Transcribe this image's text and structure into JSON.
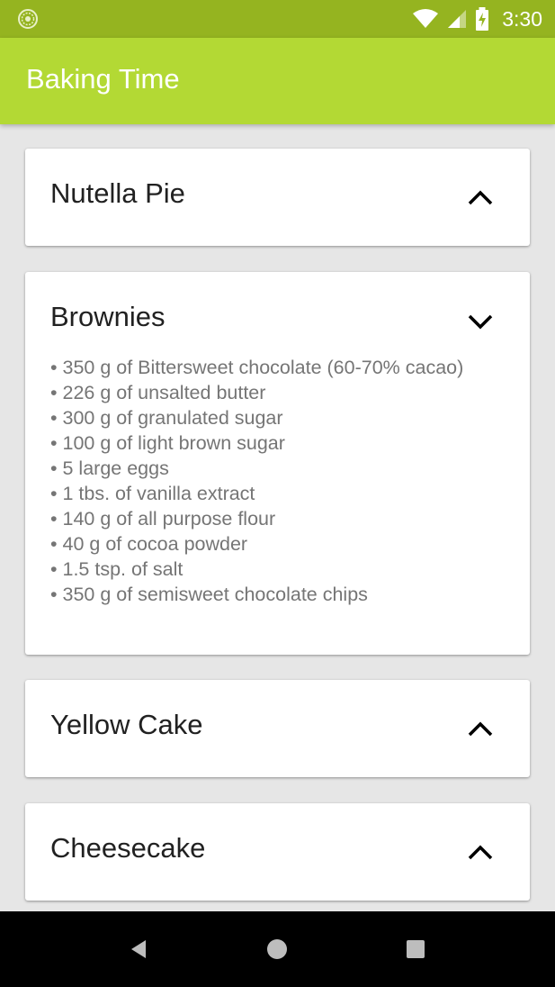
{
  "status_bar": {
    "time": "3:30",
    "icons": [
      "app-notification-icon",
      "wifi-icon",
      "cell-signal-icon",
      "battery-charging-icon"
    ]
  },
  "app_bar": {
    "title": "Baking Time",
    "color": "#b3d934",
    "status_color": "#95b420"
  },
  "recipes": [
    {
      "name": "Nutella Pie",
      "expanded": false,
      "toggle_icon": "chevron-up-icon"
    },
    {
      "name": "Brownies",
      "expanded": true,
      "toggle_icon": "chevron-down-icon",
      "ingredients": [
        "• 350 g of Bittersweet chocolate (60-70% cacao)",
        "• 226 g of unsalted butter",
        "• 300 g of granulated sugar",
        "• 100 g of light brown sugar",
        "• 5 large eggs",
        "• 1 tbs. of vanilla extract",
        "• 140 g of all purpose flour",
        "• 40 g of cocoa powder",
        "• 1.5 tsp. of salt",
        "• 350 g of semisweet chocolate chips"
      ]
    },
    {
      "name": "Yellow Cake",
      "expanded": false,
      "toggle_icon": "chevron-up-icon"
    },
    {
      "name": "Cheesecake",
      "expanded": false,
      "toggle_icon": "chevron-up-icon"
    }
  ],
  "nav_bar": {
    "buttons": [
      "back-icon",
      "home-icon",
      "recents-icon"
    ]
  }
}
